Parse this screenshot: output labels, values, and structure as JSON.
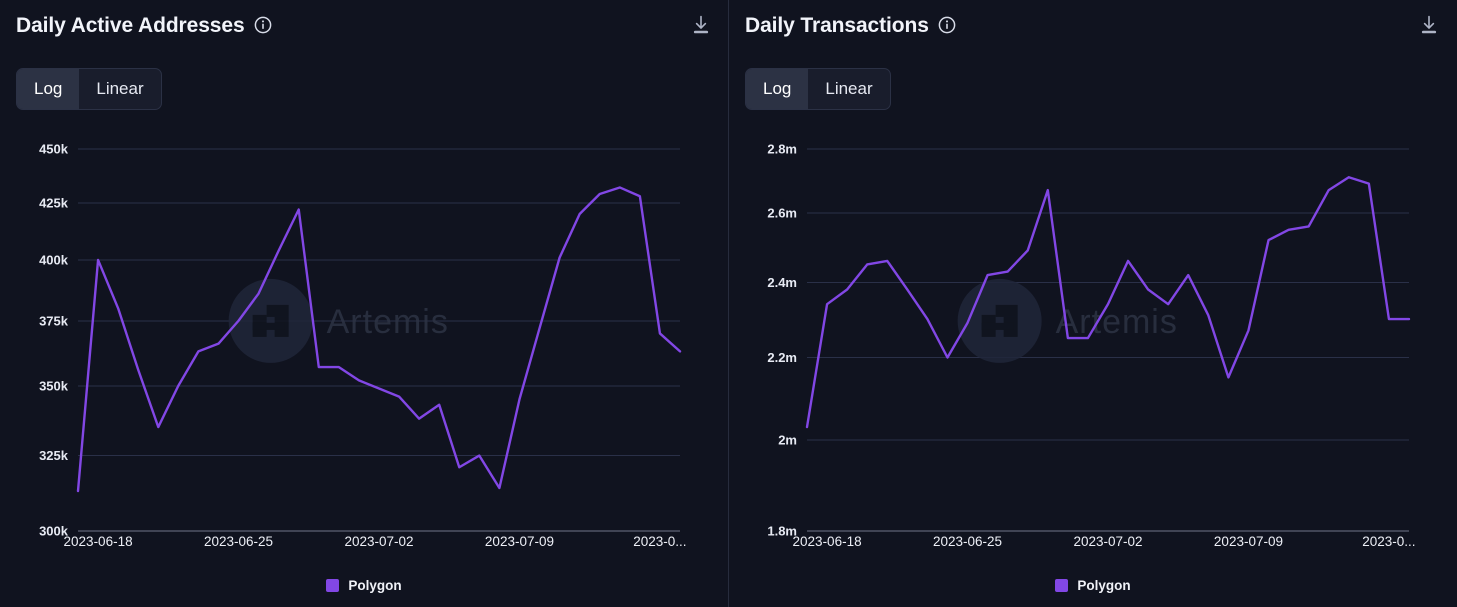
{
  "theme": {
    "background": "#10131f",
    "accent": "#8247e5",
    "line_color": "#7b3fe4",
    "grid_color": "#2a3048",
    "divider_color": "#272c3d",
    "text_color": "#eef0f7"
  },
  "watermark": {
    "text": "Artemis",
    "logo_name": "artemis-logo"
  },
  "panels": [
    {
      "id": "daily-active-addresses",
      "title": "Daily Active Addresses",
      "info_icon": "info-icon",
      "download_icon": "download-icon",
      "scale_toggle": {
        "options": [
          "Log",
          "Linear"
        ],
        "selected": "Log"
      },
      "legend": [
        {
          "label": "Polygon",
          "color": "#8247e5"
        }
      ],
      "chart_data": {
        "type": "line",
        "title": "Daily Active Addresses",
        "xlabel": "",
        "ylabel": "",
        "yscale": "log",
        "ylim": [
          300000,
          450000
        ],
        "grid": true,
        "legend_position": "bottom",
        "yticks": [
          300000,
          325000,
          350000,
          375000,
          400000,
          425000,
          450000
        ],
        "ytick_labels": [
          "300k",
          "325k",
          "350k",
          "375k",
          "400k",
          "425k",
          "450k"
        ],
        "xtick_labels": [
          "2023-06-18",
          "2023-06-25",
          "2023-07-02",
          "2023-07-09",
          "2023-0..."
        ],
        "x": [
          "2023-06-17",
          "2023-06-18",
          "2023-06-19",
          "2023-06-20",
          "2023-06-21",
          "2023-06-22",
          "2023-06-23",
          "2023-06-24",
          "2023-06-25",
          "2023-06-26",
          "2023-06-27",
          "2023-06-28",
          "2023-06-29",
          "2023-06-30",
          "2023-07-01",
          "2023-07-02",
          "2023-07-03",
          "2023-07-04",
          "2023-07-05",
          "2023-07-06",
          "2023-07-07",
          "2023-07-08",
          "2023-07-09",
          "2023-07-10",
          "2023-07-11",
          "2023-07-12",
          "2023-07-13",
          "2023-07-14",
          "2023-07-15",
          "2023-07-16",
          "2023-07-17"
        ],
        "series": [
          {
            "name": "Polygon",
            "color": "#8247e5",
            "values": [
              313000,
              400000,
              380000,
              356000,
              335000,
              350000,
              363000,
              366000,
              375000,
              386000,
              404000,
              422000,
              357000,
              357000,
              352000,
              349000,
              346000,
              338000,
              343000,
              321000,
              325000,
              314000,
              345000,
              372000,
              401000,
              420000,
              429000,
              432000,
              428000,
              370000,
              363000
            ]
          }
        ]
      }
    },
    {
      "id": "daily-transactions",
      "title": "Daily Transactions",
      "info_icon": "info-icon",
      "download_icon": "download-icon",
      "scale_toggle": {
        "options": [
          "Log",
          "Linear"
        ],
        "selected": "Log"
      },
      "legend": [
        {
          "label": "Polygon",
          "color": "#8247e5"
        }
      ],
      "chart_data": {
        "type": "line",
        "title": "Daily Transactions",
        "xlabel": "",
        "ylabel": "",
        "yscale": "log",
        "ylim": [
          1800000,
          2900000
        ],
        "grid": true,
        "legend_position": "bottom",
        "yticks": [
          1800000,
          2000000,
          2200000,
          2400000,
          2600000,
          2800000
        ],
        "ytick_labels": [
          "1.8m",
          "2m",
          "2.2m",
          "2.4m",
          "2.6m",
          "2.8m"
        ],
        "xtick_labels": [
          "2023-06-18",
          "2023-06-25",
          "2023-07-02",
          "2023-07-09",
          "2023-0..."
        ],
        "x": [
          "2023-06-17",
          "2023-06-18",
          "2023-06-19",
          "2023-06-20",
          "2023-06-21",
          "2023-06-22",
          "2023-06-23",
          "2023-06-24",
          "2023-06-25",
          "2023-06-26",
          "2023-06-27",
          "2023-06-28",
          "2023-06-29",
          "2023-06-30",
          "2023-07-01",
          "2023-07-02",
          "2023-07-03",
          "2023-07-04",
          "2023-07-05",
          "2023-07-06",
          "2023-07-07",
          "2023-07-08",
          "2023-07-09",
          "2023-07-10",
          "2023-07-11",
          "2023-07-12",
          "2023-07-13",
          "2023-07-14",
          "2023-07-15",
          "2023-07-16",
          "2023-07-17"
        ],
        "series": [
          {
            "name": "Polygon",
            "color": "#8247e5",
            "values": [
              2030000,
              2340000,
              2380000,
              2450000,
              2460000,
              2380000,
              2300000,
              2200000,
              2290000,
              2420000,
              2430000,
              2490000,
              2670000,
              2250000,
              2250000,
              2340000,
              2460000,
              2380000,
              2340000,
              2420000,
              2310000,
              2150000,
              2270000,
              2520000,
              2550000,
              2560000,
              2670000,
              2710000,
              2690000,
              2300000,
              2300000
            ]
          }
        ]
      }
    }
  ]
}
